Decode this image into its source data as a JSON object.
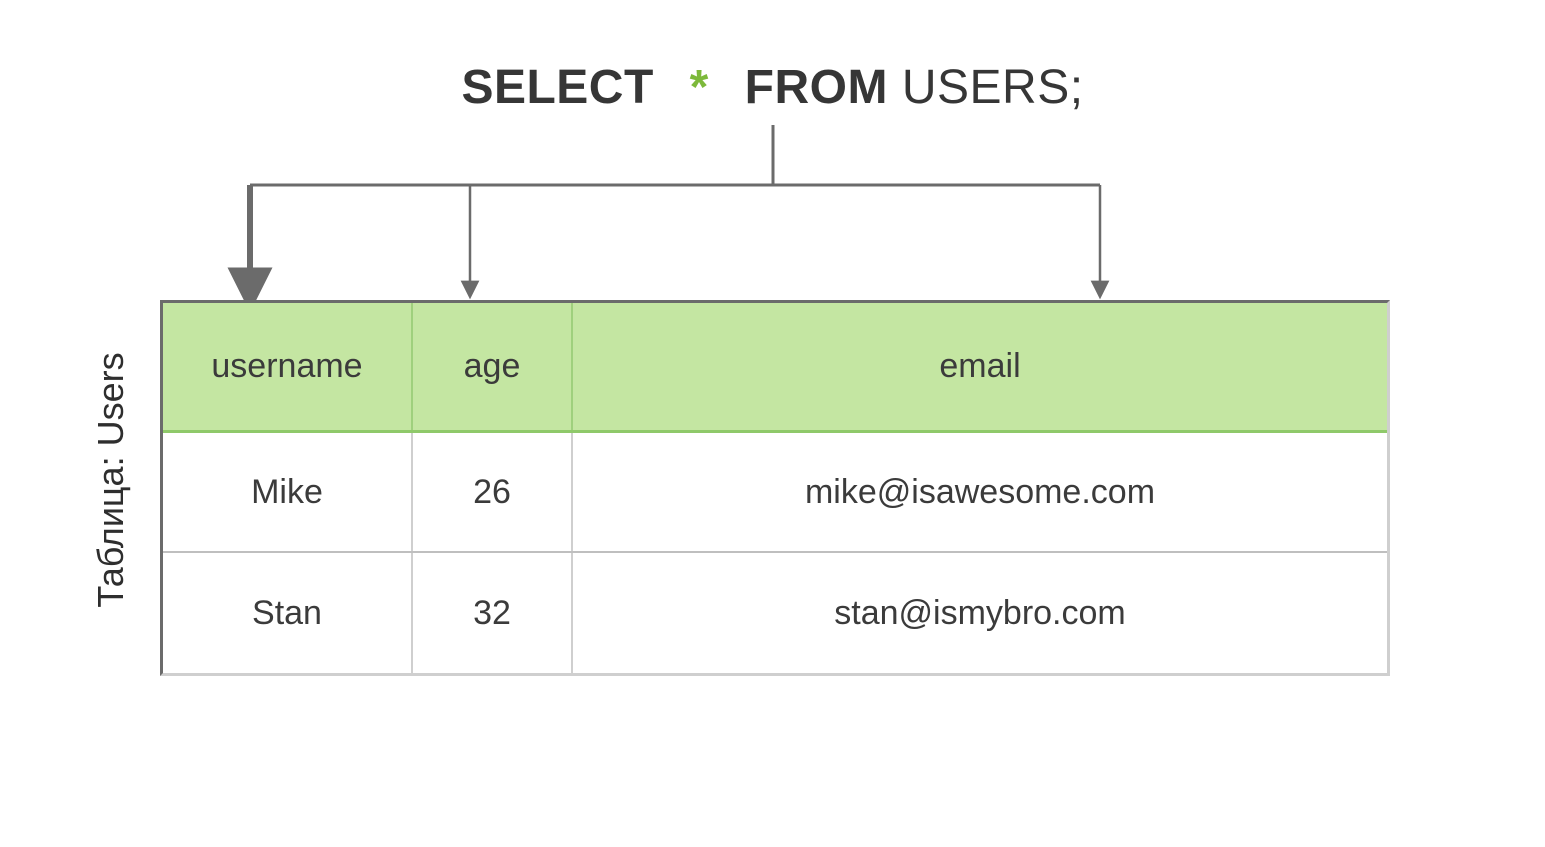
{
  "sql": {
    "select": "SELECT",
    "star": "*",
    "from": "FROM",
    "table": "USERS;",
    "full": "SELECT * FROM USERS;"
  },
  "caption": "Таблица: Users",
  "columns": {
    "username": "username",
    "age": "age",
    "email": "email"
  },
  "rows": [
    {
      "username": "Mike",
      "age": "26",
      "email": "mike@isawesome.com"
    },
    {
      "username": "Stan",
      "age": "32",
      "email": "stan@ismybro.com"
    }
  ],
  "colors": {
    "accent_green": "#7db93b",
    "header_fill": "#c4e6a2",
    "border_gray": "#6b6b6b"
  }
}
